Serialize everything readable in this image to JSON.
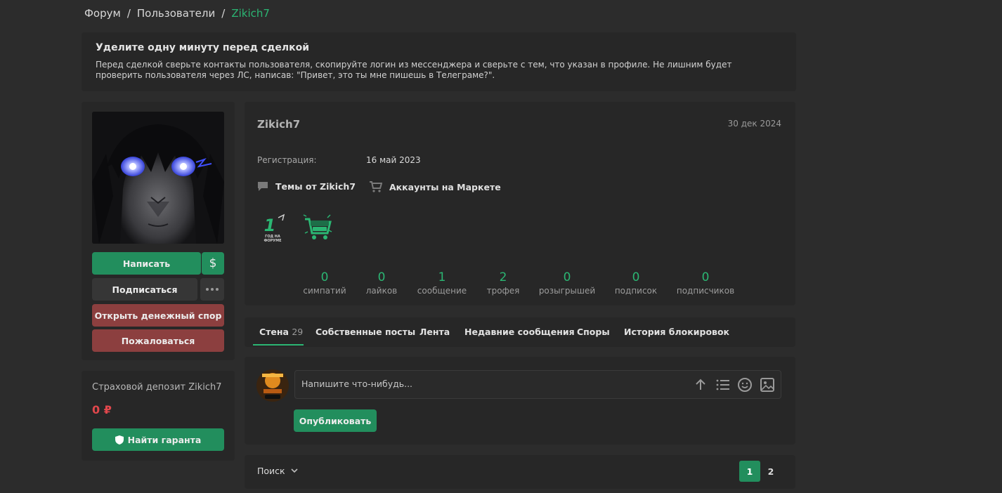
{
  "breadcrumb": {
    "items": [
      "Форум",
      "Пользователи"
    ],
    "separator": "/",
    "current": "Zikich7"
  },
  "notice": {
    "title": "Уделите одну минуту перед сделкой",
    "text": "Перед сделкой сверьте контакты пользователя, скопируйте логин из мессенджера и сверьте с тем, что указан в профиле. Не лишним будет проверить пользователя через ЛС, написав: \"Привет, это ты мне пишешь в Телеграме?\"."
  },
  "actions": {
    "write": "Написать",
    "currency": "$",
    "subscribe": "Подписаться",
    "dispute": "Открыть денежный спор",
    "report": "Пожаловаться"
  },
  "deposit": {
    "title": "Страховой депозит Zikich7",
    "amount": "0 ₽",
    "guarantor": "Найти гаранта"
  },
  "profile": {
    "username": "Zikich7",
    "date": "30 дек 2024",
    "registration_label": "Регистрация:",
    "registration_value": "16 май 2023",
    "topics_link": "Темы от Zikich7",
    "market_link": "Аккаунты на Маркете",
    "trophy_1_year": "1",
    "trophy_1_text": "ГОД НА ФОРУМЕ"
  },
  "stats": [
    {
      "value": "0",
      "label": "симпатий"
    },
    {
      "value": "0",
      "label": "лайков"
    },
    {
      "value": "1",
      "label": "сообщение"
    },
    {
      "value": "2",
      "label": "трофея"
    },
    {
      "value": "0",
      "label": "розыгрышей"
    },
    {
      "value": "0",
      "label": "подписок"
    },
    {
      "value": "0",
      "label": "подписчиков"
    }
  ],
  "tabs": {
    "wall": "Стена",
    "wall_count": "29",
    "own_posts": "Собственные посты",
    "feed": "Лента",
    "recent": "Недавние сообщения",
    "disputes": "Споры",
    "ban_history": "История блокировок"
  },
  "composer": {
    "placeholder": "Напишите что-нибудь...",
    "publish": "Опубликовать"
  },
  "footer": {
    "sort": "Поиск",
    "pages": [
      "1",
      "2"
    ]
  },
  "colors": {
    "accent": "#2bb673",
    "button_green": "#228e5d",
    "button_red": "#8c3f3f",
    "amount_red": "#e0474c"
  }
}
